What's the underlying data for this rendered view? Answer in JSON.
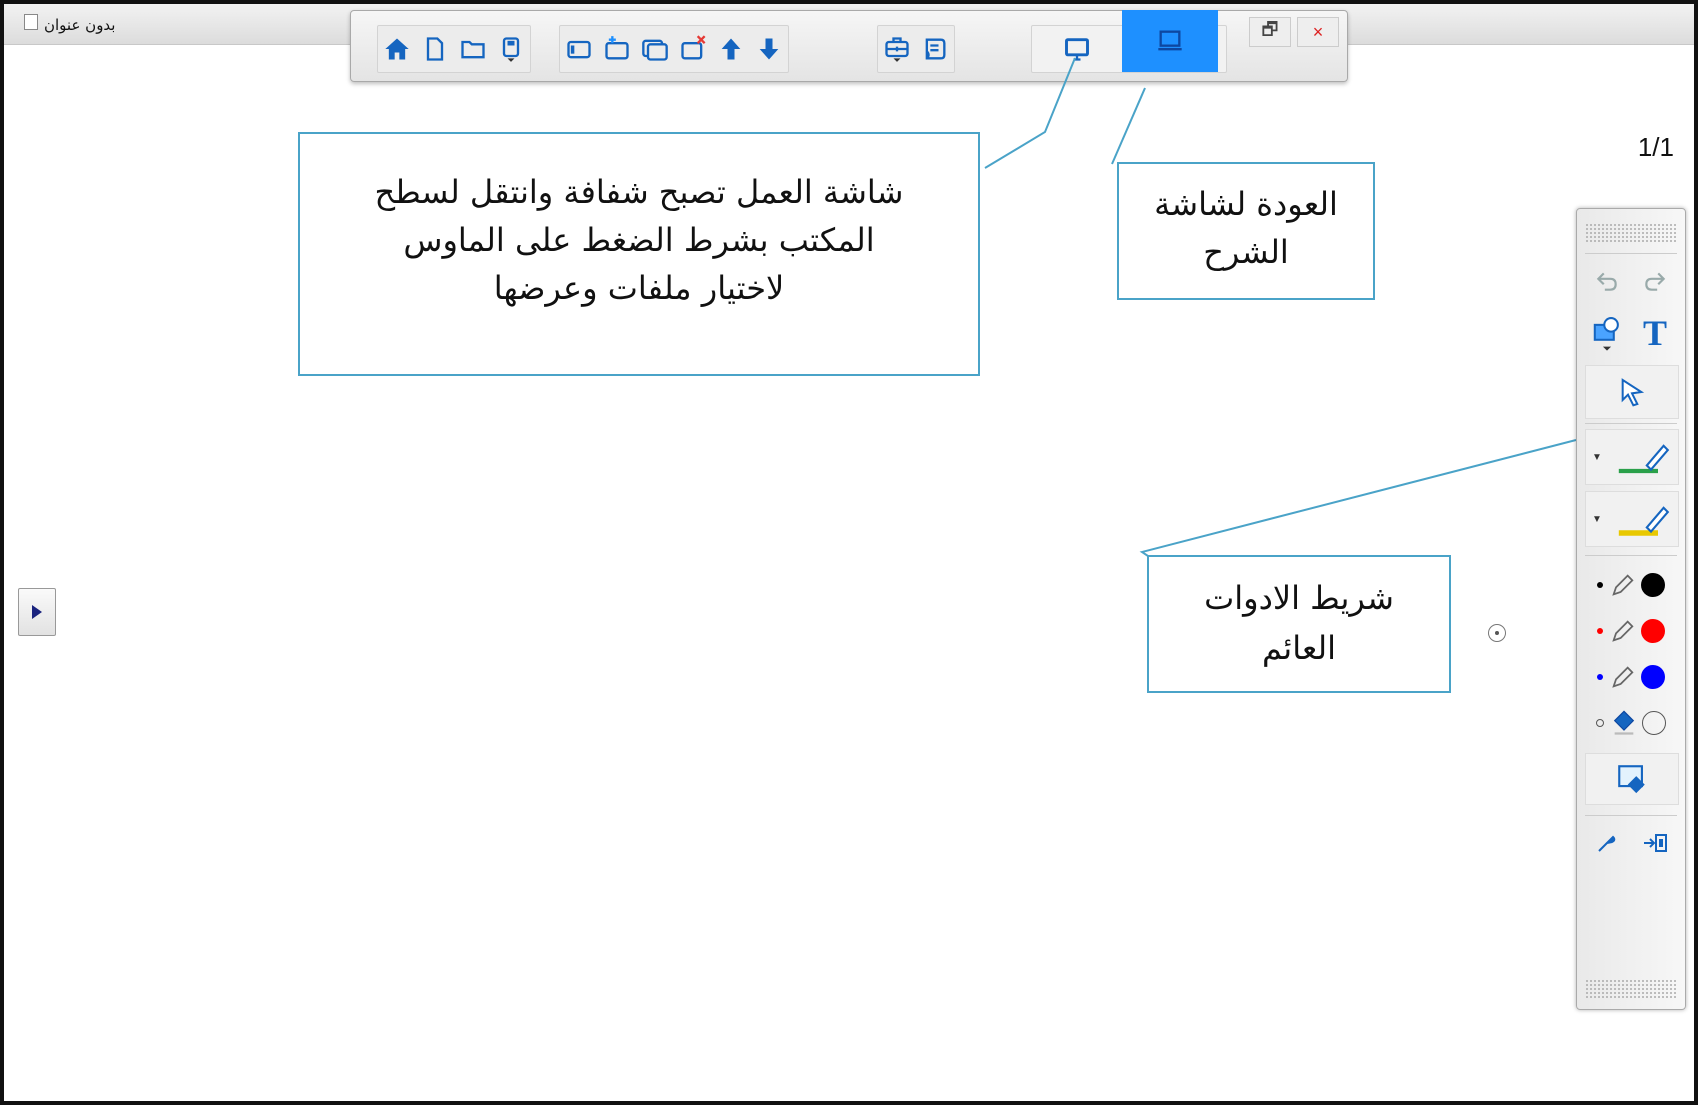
{
  "window": {
    "title": "بدون عنوان",
    "page_indicator": "1/1"
  },
  "toolbar": {
    "buttons": [
      "home-icon",
      "new-page-icon",
      "open-folder-icon",
      "save-icon",
      "page-sorter-icon",
      "add-page-icon",
      "duplicate-page-icon",
      "delete-page-icon",
      "arrow-up-icon",
      "arrow-down-icon",
      "toolbox-icon",
      "gallery-icon",
      "desktop-mode-icon",
      "board-mode-icon"
    ],
    "active_button": "board-mode-icon",
    "window_buttons": {
      "restore": "🗗",
      "close": "×"
    }
  },
  "callouts": {
    "desktop_mode": {
      "line1": "شاشة العمل تصبح شفافة وانتقل  لسطح",
      "line2": "المكتب  بشرط  الضغط على الماوس",
      "line3": "لاختيار ملفات وعرضها"
    },
    "back_to_board": {
      "line1": "العودة لشاشة",
      "line2": "الشرح"
    },
    "floating_toolbar": {
      "line1": "شريط الادوات",
      "line2": "العائم"
    }
  },
  "floating_toolbar": {
    "text_tool_label": "T",
    "pen_colors": [
      "#000000",
      "#ff0000",
      "#0000ff"
    ],
    "highlighter_colors": [
      "#2aa04a",
      "#e8c800"
    ],
    "accent": "#1e90ff"
  }
}
